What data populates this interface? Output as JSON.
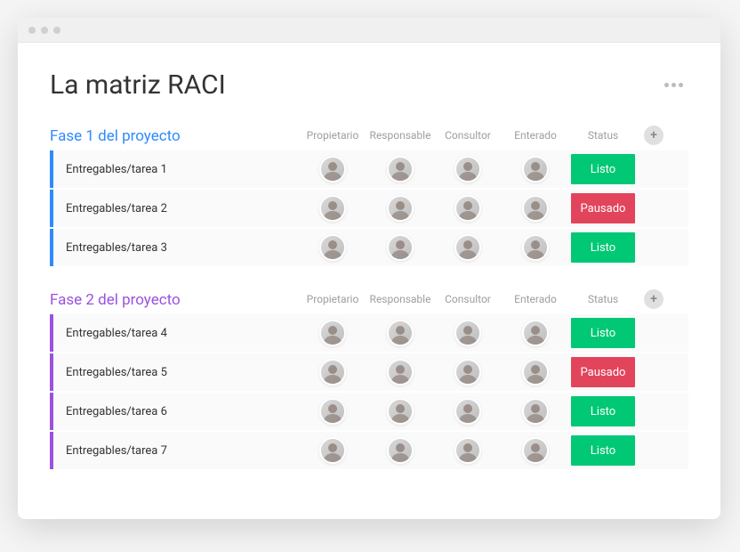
{
  "page": {
    "title": "La matriz RACI"
  },
  "columns": {
    "owner": "Propietario",
    "responsible": "Responsable",
    "consultant": "Consultor",
    "informed": "Enterado",
    "status": "Status"
  },
  "status_labels": {
    "listo": "Listo",
    "pausado": "Pausado"
  },
  "phases": [
    {
      "title": "Fase 1 del proyecto",
      "rows": [
        {
          "name": "Entregables/tarea 1",
          "status": "listo"
        },
        {
          "name": "Entregables/tarea 2",
          "status": "pausado"
        },
        {
          "name": "Entregables/tarea 3",
          "status": "listo"
        }
      ]
    },
    {
      "title": "Fase 2 del proyecto",
      "rows": [
        {
          "name": "Entregables/tarea 4",
          "status": "listo"
        },
        {
          "name": "Entregables/tarea 5",
          "status": "pausado"
        },
        {
          "name": "Entregables/tarea 6",
          "status": "listo"
        },
        {
          "name": "Entregables/tarea 7",
          "status": "listo"
        }
      ]
    }
  ]
}
